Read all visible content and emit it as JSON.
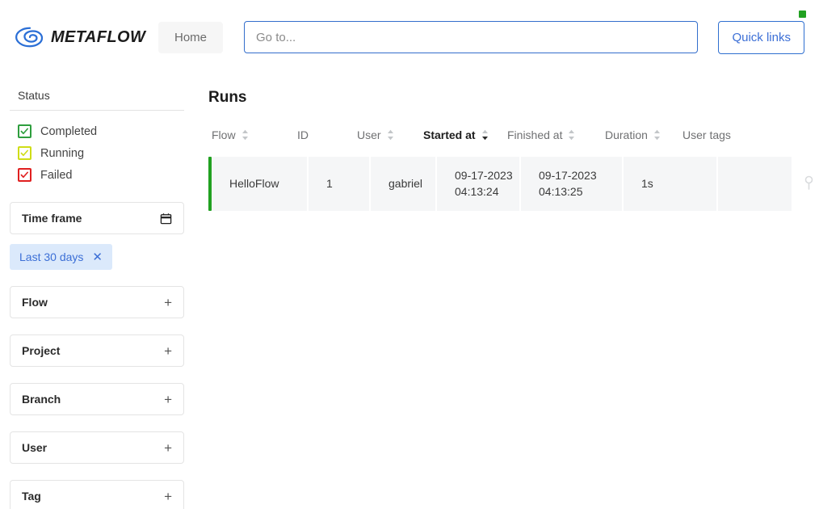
{
  "header": {
    "brand_name": "METAFLOW",
    "brand_logo_icon": "metaflow-eye-logo",
    "home_label": "Home",
    "search_placeholder": "Go to...",
    "search_value": "",
    "quick_links_label": "Quick links",
    "connection_indicator_color": "#21a121"
  },
  "sidebar": {
    "status_title": "Status",
    "status_items": [
      {
        "label": "Completed",
        "color": "#2e9e3e",
        "checked": true
      },
      {
        "label": "Running",
        "color": "#cfdd17",
        "checked": true
      },
      {
        "label": "Failed",
        "color": "#e02020",
        "checked": true
      }
    ],
    "timeframe": {
      "label": "Time frame",
      "icon": "calendar-icon",
      "chip_label": "Last 30 days",
      "chip_close_icon": "close-icon"
    },
    "filters": [
      {
        "label": "Flow",
        "expand_icon": "plus-icon"
      },
      {
        "label": "Project",
        "expand_icon": "plus-icon"
      },
      {
        "label": "Branch",
        "expand_icon": "plus-icon"
      },
      {
        "label": "User",
        "expand_icon": "plus-icon"
      },
      {
        "label": "Tag",
        "expand_icon": "plus-icon"
      }
    ]
  },
  "main": {
    "page_title": "Runs",
    "table": {
      "columns": [
        {
          "label": "Flow",
          "sortable": true,
          "active": false
        },
        {
          "label": "ID",
          "sortable": false,
          "active": false
        },
        {
          "label": "User",
          "sortable": true,
          "active": false
        },
        {
          "label": "Started at",
          "sortable": true,
          "active": true
        },
        {
          "label": "Finished at",
          "sortable": true,
          "active": false
        },
        {
          "label": "Duration",
          "sortable": true,
          "active": false
        },
        {
          "label": "User tags",
          "sortable": false,
          "active": false
        }
      ],
      "rows": [
        {
          "status_color": "#21a121",
          "flow": "HelloFlow",
          "id": "1",
          "user": "gabriel",
          "started_at": "09-17-2023\n04:13:24",
          "finished_at": "09-17-2023\n04:13:25",
          "duration": "1s",
          "user_tags": "",
          "pin_icon": "pin-icon"
        }
      ]
    }
  }
}
